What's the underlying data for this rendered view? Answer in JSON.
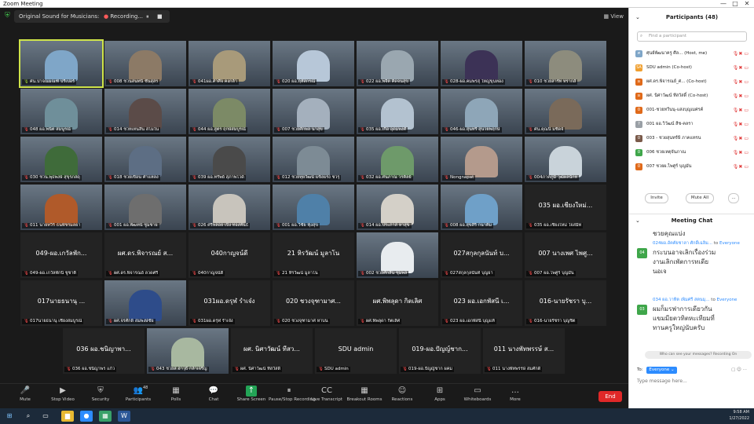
{
  "window": {
    "title": "Zoom Meeting",
    "controls": [
      "—",
      "□",
      "✕"
    ]
  },
  "topbar": {
    "original_sound": "Original Sound for Musicians: Off",
    "recording": "Recording...",
    "rec_controls": [
      "⏸",
      "■"
    ],
    "view": "View"
  },
  "gallery": {
    "rows": [
      [
        {
          "title": "",
          "name": "ศน.ปาจณมณฑ์ ปรีเปอร์",
          "video": true,
          "active": true,
          "color": "#7fa6c8"
        },
        {
          "title": "",
          "name": "008 ชวนสนทนี ชันสุสร",
          "video": true,
          "color": "#8c7a66"
        },
        {
          "title": "",
          "name": "041ผอ.ศาศิจ คงกล้า",
          "video": true,
          "color": "#a89a7a"
        },
        {
          "title": "",
          "name": "020 ผอ.ฤหัสกรณ์",
          "video": true,
          "color": "#b7c7d8"
        },
        {
          "title": "",
          "name": "022 ผอ.พจีต คิดจนสุข",
          "video": true,
          "color": "#9aa7b0"
        },
        {
          "title": "",
          "name": "028-ผอ.คมพรสุ ใหญ่ขุนทอง",
          "video": true,
          "color": "#3c3256"
        },
        {
          "title": "",
          "name": "010 ชวยสารัท ทรากส์",
          "video": true,
          "color": "#8d8c7d"
        }
      ],
      [
        {
          "title": "",
          "name": "048 ผอ.พนิต สมนูรณ์",
          "video": true,
          "color": "#6f8f9a"
        },
        {
          "title": "",
          "name": "014 ชวทเหนสิน สโมใน",
          "video": true,
          "color": "#5b4b48"
        },
        {
          "title": "",
          "name": "044 ผอ.สูตร ฤกษ์สมบูรณ์",
          "video": true,
          "color": "#7c8a66"
        },
        {
          "title": "",
          "name": "007 ชวยศักพล นาสุข",
          "video": true,
          "color": "#a4b0bd"
        },
        {
          "title": "",
          "name": "035 ผอ.เกื้อ อุดมพงศ์",
          "video": true,
          "color": "#b3c2d0"
        },
        {
          "title": "",
          "name": "046-ผอ.สุนทรี สุนวยพฤกษ์",
          "video": true,
          "color": "#8ea6b8"
        },
        {
          "title": "",
          "name": "ศน.คุณนิ มชิดจ์",
          "video": true,
          "color": "#7a6a5a"
        }
      ],
      [
        {
          "title": "",
          "name": "030 ชวน.พุธพงษ์ สุขุรภสดุ",
          "video": true,
          "color": "#3f6b3a"
        },
        {
          "title": "",
          "name": "018 ชวยเขื่อน คำแหลง",
          "video": true,
          "color": "#5d6e84"
        },
        {
          "title": "",
          "name": "039 ผอ.ทรัพย์ สุภาพไวด์",
          "video": true,
          "color": "#4a4a4a"
        },
        {
          "title": "",
          "name": "012 ชวยทุยวัฒน์ แข็งแรง ชวรุ",
          "video": true,
          "color": "#7d8b95"
        },
        {
          "title": "",
          "name": "032 ผอ.ศนภาณ วรคิลย์",
          "video": true,
          "color": "#6e9a6a"
        },
        {
          "title": "",
          "name": "Nongnapat",
          "video": true,
          "color": "#b49a8c"
        },
        {
          "title": "",
          "name": "004ภาคภูมิ วุฒิผลนักท",
          "video": true,
          "color": "#c9d3da"
        }
      ],
      [
        {
          "title": "",
          "name": "011 นายทวีร์ ธนพัชรมลยา",
          "video": true,
          "color": "#b05a2a"
        },
        {
          "title": "",
          "name": "001 ผอ.พัฒทน์ ชูมชาย",
          "video": true,
          "color": "#6e6e6e"
        },
        {
          "title": "",
          "name": "026 ศรีพลอย เป็ง ทองพันธ์",
          "video": true,
          "color": "#c8c4bc"
        },
        {
          "title": "",
          "name": "001 ผอ.วิชัย ฟุ้งสุข",
          "video": true,
          "color": "#4f80a8"
        },
        {
          "title": "",
          "name": "014 ผอ.ประภาส หาสุข",
          "video": true,
          "color": "#d4d0c8"
        },
        {
          "title": "",
          "name": "008 ผอ.สุขสิริ กนาคิม",
          "video": true,
          "color": "#6fa0c8"
        },
        {
          "title": "035 ผอ.เชี่ยงใหม่...",
          "name": "035 ผอ.เชี่ยงใหม่ ใจสมิท",
          "video": false
        }
      ],
      [
        {
          "title": "049-ผอ.เกวัลพัก...",
          "name": "049-ผอ.เกวัลพักนี ชูชาติ",
          "video": false
        },
        {
          "title": "ผศ.ดร.พิจารณย์ ส...",
          "name": "ผศ.ดร.พิจารณย์ ลวดศรี",
          "video": false
        },
        {
          "title": "040กาญจน์ดี",
          "name": "040กาญจน์ดี",
          "video": false
        },
        {
          "title": "21 หิรวัฒน์ มูลาโน",
          "name": "21 หิรวัฒน์ มูลาโน",
          "video": false
        },
        {
          "title": "",
          "name": "002 ชวยศักสิน ชุมพล",
          "video": true,
          "color": "#e8ecef"
        },
        {
          "title": "027สกุลกุลนันท์ บ...",
          "name": "027สกุลกุลนันท์ บุญยา",
          "video": false
        },
        {
          "title": "007 นางเพศ ไพศู...",
          "name": "007 ผอ.ไพศูร์ บุญมัน",
          "video": false
        }
      ],
      [
        {
          "title": "017นายธนานุ ...",
          "name": "017นายธนานุ เชียงสมบูรณ์",
          "video": false
        },
        {
          "title": "",
          "name": "ผศ.จรศักดิ์ สมพงษ์ชัย",
          "video": true,
          "color": "#2e4c8a"
        },
        {
          "title": "031ผอ.ดรุฬ รำเจ๋ง",
          "name": "031ผอ.ดรุฬ รำเจ๋ง",
          "video": false
        },
        {
          "title": "020 ชวงจุฑามาศ...",
          "name": "020 ชวงจุฑามาศ หาบน",
          "video": false
        },
        {
          "title": "ผศ.พิพลุดา กิตเลิศ",
          "name": "ผศ.พิพลุดา กิตเลิศ",
          "video": false
        },
        {
          "title": "023 ผอ.เอกพัสนี เ...",
          "name": "023 ผอ.เอกพัสนี บุญแท้",
          "video": false
        },
        {
          "title": "016-นายรัชรา บุ...",
          "name": "016-นายรัชรา บุญชิต",
          "video": false
        }
      ],
      [
        {
          "title": "036 ผอ.ชนิญาพา...",
          "name": "036 ผอ.ชนิญาพร แก้ว",
          "video": false
        },
        {
          "title": "",
          "name": "043 ชวยส.ฮาวุธิ กล้าเจริญ",
          "video": true,
          "color": "#a8b8a0"
        },
        {
          "title": "ผศ. นิศาวัฒน์ ทีสว...",
          "name": "ผศ. นิศาวัฒน์ ทีสวัสดิ์",
          "video": false
        },
        {
          "title": "SDU admin",
          "name": "SDU admin",
          "video": false
        },
        {
          "title": "019-ผอ.ปัญญ์ชาก...",
          "name": "019-ผอ.ปัญญ์ชาก ผคม",
          "video": false
        },
        {
          "title": "011 นางพัทพรรษ์ ส...",
          "name": "011 นางพัทพรรษ์ สมศักดิ์",
          "video": false
        }
      ]
    ]
  },
  "participants": {
    "title": "Participants (48)",
    "search_placeholder": "Find a participant",
    "list": [
      {
        "avatar": "ศ",
        "avatar_color": "#7fa6c8",
        "name": "ศุนย์พัฒนาครู ศีล... (Host, me)"
      },
      {
        "avatar": "SA",
        "avatar_color": "#f0a030",
        "name": "SDU admin (Co-host)"
      },
      {
        "avatar": "ผ",
        "avatar_color": "#e06a1a",
        "name": "ผศ.ดร.พิจารณย์_ศ... (Co-host)"
      },
      {
        "avatar": "ผ",
        "avatar_color": "#e06a1a",
        "name": "ผศ. นิศาวัฒน์ ทีสวัสดิ์ (Co-host)"
      },
      {
        "avatar": "0",
        "avatar_color": "#e06a1a",
        "name": "001-ชวยทวีนนุ-แสงบุญเมศรค์"
      },
      {
        "avatar": "?",
        "avatar_color": "#9aa0a6",
        "name": "001 ผอ.วิวัฒน์ สีช-คลรา"
      },
      {
        "avatar": "0",
        "avatar_color": "#7a5a4a",
        "name": "003 - ชวยสุนทร์ษี ภาคแทรน"
      },
      {
        "avatar": "0",
        "avatar_color": "#3fa64a",
        "name": "006 ชวยเหตุจันภาณ"
      },
      {
        "avatar": "0",
        "avatar_color": "#e06a1a",
        "name": "007 ชวยผ.ไพศูร์ บุญมัน"
      }
    ],
    "invite": "Invite",
    "mute_all": "Mute All",
    "more": "..."
  },
  "chat": {
    "title": "Meeting Chat",
    "partial_line": "ชวยคุณแบ่ง",
    "messages": [
      {
        "avatar": "04",
        "sender": "024ผอ.อัคคัยชาลา ศักดิ์เฉลิม...",
        "to": "to",
        "recipient": "Everyone",
        "lines": [
          "กระบนอาจเลิกเรื่องร่วม",
          "งานเลิกเพัตการทเดีย",
          "นอเจ"
        ]
      },
      {
        "avatar": "03",
        "sender": "034 ผอ.วาทิต เพิ่มศรี สตนมุ...",
        "to": "to",
        "recipient": "Everyone",
        "lines": [
          "ผมก็มรฟาการเดียวกัน",
          "แขมมียตวทิตหะเทียมที่",
          "ทานครูใหญ่นับครับ"
        ]
      }
    ],
    "privacy": "Who can see your messages? Recording On",
    "to_label": "To:",
    "to_value": "Everyone",
    "input_placeholder": "Type message here..."
  },
  "toolbar": {
    "items": [
      {
        "icon": "🎤",
        "label": "Mute"
      },
      {
        "icon": "▶",
        "label": "Stop Video"
      },
      {
        "icon": "⛨",
        "label": "Security"
      },
      {
        "icon": "👥",
        "label": "Participants",
        "badge": "48"
      },
      {
        "icon": "▦",
        "label": "Polls"
      },
      {
        "icon": "💬",
        "label": "Chat"
      },
      {
        "icon": "↑",
        "label": "Share Screen"
      },
      {
        "icon": "⏸",
        "label": "Pause/Stop Recording"
      },
      {
        "icon": "CC",
        "label": "Live Transcript"
      },
      {
        "icon": "▦",
        "label": "Breakout Rooms"
      },
      {
        "icon": "☺",
        "label": "Reactions"
      },
      {
        "icon": "⊞",
        "label": "Apps"
      },
      {
        "icon": "▭",
        "label": "Whiteboards"
      },
      {
        "icon": "…",
        "label": "More"
      }
    ],
    "end": "End"
  },
  "taskbar": {
    "start": "⊞",
    "time": "9:58 AM",
    "date": "1/27/2022"
  }
}
